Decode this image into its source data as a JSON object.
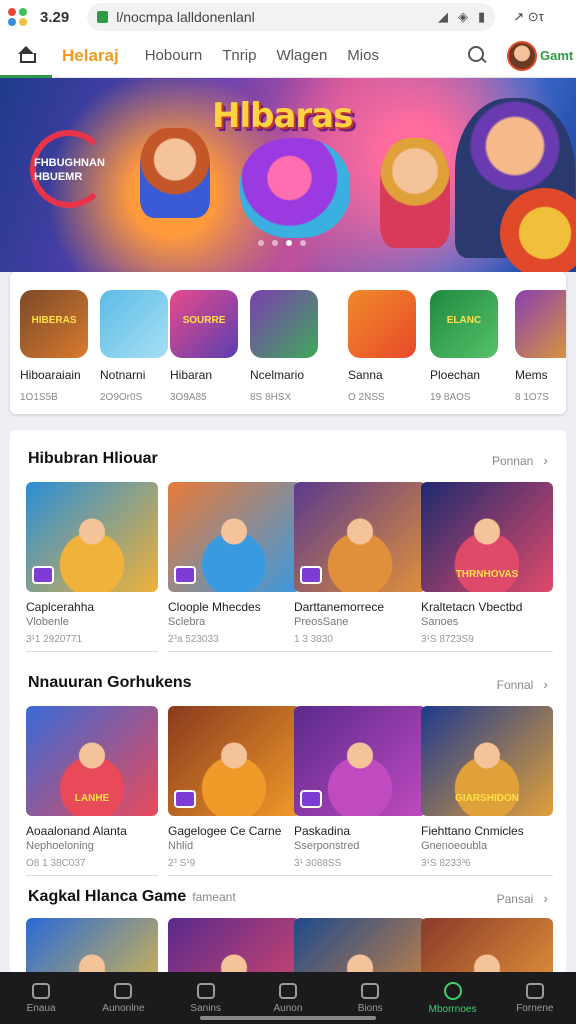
{
  "status_bar": {
    "time": "3.29",
    "url": "l/nocmpa lalldonenlanl",
    "right": "↗ ⊙τ"
  },
  "top_nav": {
    "brand": "Helaraj",
    "tabs": [
      "Hobourn",
      "Tnrip",
      "Wlagen",
      "Mios"
    ],
    "user": "Gamt"
  },
  "hero": {
    "title": "Hlbaras",
    "promo": "FHBUGHNAN HBUEMR",
    "dots_total": 4,
    "active_dot": 2
  },
  "apps": [
    {
      "icon_label": "HIBERAS",
      "name": "Hiboaraiain",
      "meta": "1O1S5B",
      "colors": [
        "#7b4a2a",
        "#d97a2d"
      ]
    },
    {
      "icon_label": "",
      "name": "Notnarni",
      "meta": "2O9Or0S",
      "colors": [
        "#5bbbe6",
        "#a8e0f5"
      ]
    },
    {
      "icon_label": "SOURRE",
      "name": "Hibaran",
      "meta": "3O9A85",
      "colors": [
        "#e84a8c",
        "#5b3fb0"
      ]
    },
    {
      "icon_label": "",
      "name": "Ncelmario",
      "meta": "8S 8HSX",
      "colors": [
        "#7b3fb0",
        "#3fa85a"
      ]
    },
    {
      "icon_label": "",
      "name": "Sanna",
      "meta": "O 2NSS",
      "colors": [
        "#f08a2a",
        "#e84a2a"
      ]
    },
    {
      "icon_label": "ELANC",
      "name": "Ploechan",
      "meta": "19 8AOS",
      "colors": [
        "#1e8a3e",
        "#57c16a"
      ]
    },
    {
      "icon_label": "",
      "name": "Mems",
      "meta": "8 1O7S",
      "colors": [
        "#8a3fb0",
        "#e0a030"
      ]
    }
  ],
  "sections": [
    {
      "title": "Hibubran Hliouar",
      "subtitle": "",
      "more": "Ponnan",
      "cards": [
        {
          "title": "Caplcerahha",
          "sub": "Vlobenle",
          "meta": "3¹1 2920771",
          "colors": [
            "#2a8ed6",
            "#f0b23a"
          ],
          "label": ""
        },
        {
          "title": "Cloople Mhecdes",
          "sub": "Sclebra",
          "meta": "2³a 523033",
          "colors": [
            "#e87a3a",
            "#3a9ae0"
          ],
          "label": ""
        },
        {
          "title": "Darttanemorrece",
          "sub": "PreosSane",
          "meta": "1 3 3830",
          "colors": [
            "#5a3a8c",
            "#e0903a"
          ],
          "label": ""
        },
        {
          "title": "Kraltetacn Vbectbd",
          "sub": "Sanoes",
          "meta": "3¹S 8723S9",
          "colors": [
            "#1e2a6e",
            "#e04a6a"
          ],
          "label": "THRNHOVAS"
        }
      ]
    },
    {
      "title": "Nnauuran Gorhukens",
      "subtitle": "",
      "more": "Fonnal",
      "cards": [
        {
          "title": "Aoaalonand Alanta",
          "sub": "Nephoeloning",
          "meta": "O8 1 38C037",
          "colors": [
            "#3a6ad6",
            "#e84a5a"
          ],
          "label": "LANHE"
        },
        {
          "title": "Gagelogee Ce Carne",
          "sub": "Nhlid",
          "meta": "2³ S¹9",
          "colors": [
            "#8a3a1e",
            "#f09a2a"
          ],
          "label": ""
        },
        {
          "title": "Paskadina",
          "sub": "Sserponstred",
          "meta": "3¹ 3088SS",
          "colors": [
            "#5a2a8c",
            "#c04ac0"
          ],
          "label": ""
        },
        {
          "title": "Fiehttano Cnmicles",
          "sub": "Gnenoeoubla",
          "meta": "3¹S 8233³6",
          "colors": [
            "#1e3a8c",
            "#e0a03a"
          ],
          "label": "GIARSHIDON"
        }
      ]
    },
    {
      "title": "Kagkal Hlanca Game",
      "subtitle": "fameant",
      "more": "Pansai",
      "cards": [
        {
          "title": "",
          "sub": "",
          "meta": "",
          "colors": [
            "#2a6ad6",
            "#f0c03a"
          ],
          "label": ""
        },
        {
          "title": "",
          "sub": "",
          "meta": "",
          "colors": [
            "#5a2a8c",
            "#e04a6a"
          ],
          "label": ""
        },
        {
          "title": "",
          "sub": "",
          "meta": "",
          "colors": [
            "#1e4a8c",
            "#e08a3a"
          ],
          "label": ""
        },
        {
          "title": "",
          "sub": "",
          "meta": "",
          "colors": [
            "#8a3a2a",
            "#f0a03a"
          ],
          "label": ""
        }
      ]
    }
  ],
  "bottom_nav": [
    {
      "label": "Enaua",
      "icon": "home-icon",
      "active": false
    },
    {
      "label": "Aunonlne",
      "icon": "discover-icon",
      "active": false
    },
    {
      "label": "Sanins",
      "icon": "list-icon",
      "active": false
    },
    {
      "label": "Aunon",
      "icon": "calendar-icon",
      "active": false
    },
    {
      "label": "Bions",
      "icon": "chat-icon",
      "active": false
    },
    {
      "label": "Mborrnoes",
      "icon": "search-icon",
      "active": true
    },
    {
      "label": "Fornene",
      "icon": "profile-icon",
      "active": false
    }
  ],
  "colors": {
    "accent": "#2e9a43",
    "brand": "#f39b1a",
    "active_nav": "#3ecf6c"
  }
}
